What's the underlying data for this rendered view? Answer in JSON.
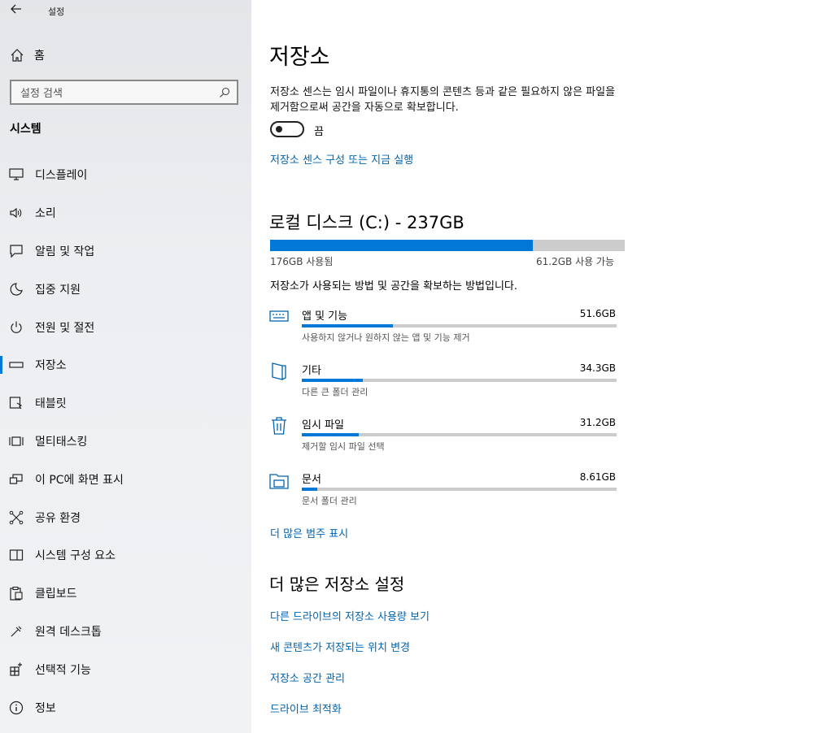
{
  "window": {
    "title": "설정",
    "back_icon": "back-arrow-icon"
  },
  "sidebar": {
    "home_label": "홈",
    "search_placeholder": "설정 검색",
    "section": "시스템",
    "items": [
      {
        "label": "디스플레이",
        "icon": "monitor-icon"
      },
      {
        "label": "소리",
        "icon": "speaker-icon"
      },
      {
        "label": "알림 및 작업",
        "icon": "notification-icon"
      },
      {
        "label": "집중 지원",
        "icon": "moon-icon"
      },
      {
        "label": "전원 및 절전",
        "icon": "power-icon"
      },
      {
        "label": "저장소",
        "icon": "storage-icon",
        "active": true
      },
      {
        "label": "태블릿",
        "icon": "tablet-icon"
      },
      {
        "label": "멀티태스킹",
        "icon": "multitasking-icon"
      },
      {
        "label": "이 PC에 화면 표시",
        "icon": "project-icon"
      },
      {
        "label": "공유 환경",
        "icon": "share-icon"
      },
      {
        "label": "시스템 구성 요소",
        "icon": "components-icon"
      },
      {
        "label": "클립보드",
        "icon": "clipboard-icon"
      },
      {
        "label": "원격 데스크톱",
        "icon": "remote-desktop-icon"
      },
      {
        "label": "선택적 기능",
        "icon": "optional-features-icon"
      },
      {
        "label": "정보",
        "icon": "info-icon"
      }
    ]
  },
  "main": {
    "title": "저장소",
    "sense_desc": "저장소 센스는 임시 파일이나 휴지통의 콘텐츠 등과 같은 필요하지 않은 파일을 제거함으로써 공간을 자동으로 확보합니다.",
    "toggle_label": "끔",
    "sense_link": "저장소 센스 구성 또는 지금 실행",
    "disk_title": "로컬 디스크 (C:) - 237GB",
    "used_label": "176GB 사용됨",
    "free_label": "61.2GB 사용 가능",
    "usage_fraction": 0.74,
    "usage_desc": "저장소가 사용되는 방법 및 공간을 확보하는 방법입니다.",
    "categories": [
      {
        "name": "앱 및 기능",
        "size": "51.6GB",
        "sub": "사용하지 않거나 원하지 않는 앱 및 기능 제거",
        "fraction": 0.29,
        "icon": "apps-icon"
      },
      {
        "name": "기타",
        "size": "34.3GB",
        "sub": "다른 큰 폴더 관리",
        "fraction": 0.195,
        "icon": "other-folder-icon"
      },
      {
        "name": "임시 파일",
        "size": "31.2GB",
        "sub": "제거할 임시 파일 선택",
        "fraction": 0.18,
        "icon": "trash-icon"
      },
      {
        "name": "문서",
        "size": "8.61GB",
        "sub": "문서 폴더 관리",
        "fraction": 0.05,
        "icon": "documents-icon"
      }
    ],
    "more_categories_link": "더 많은 범주 표시",
    "more_settings_title": "더 많은 저장소 설정",
    "more_links": [
      "다른 드라이브의 저장소 사용량 보기",
      "새 콘텐츠가 저장되는 위치 변경",
      "저장소 공간 관리",
      "드라이브 최적화"
    ]
  }
}
